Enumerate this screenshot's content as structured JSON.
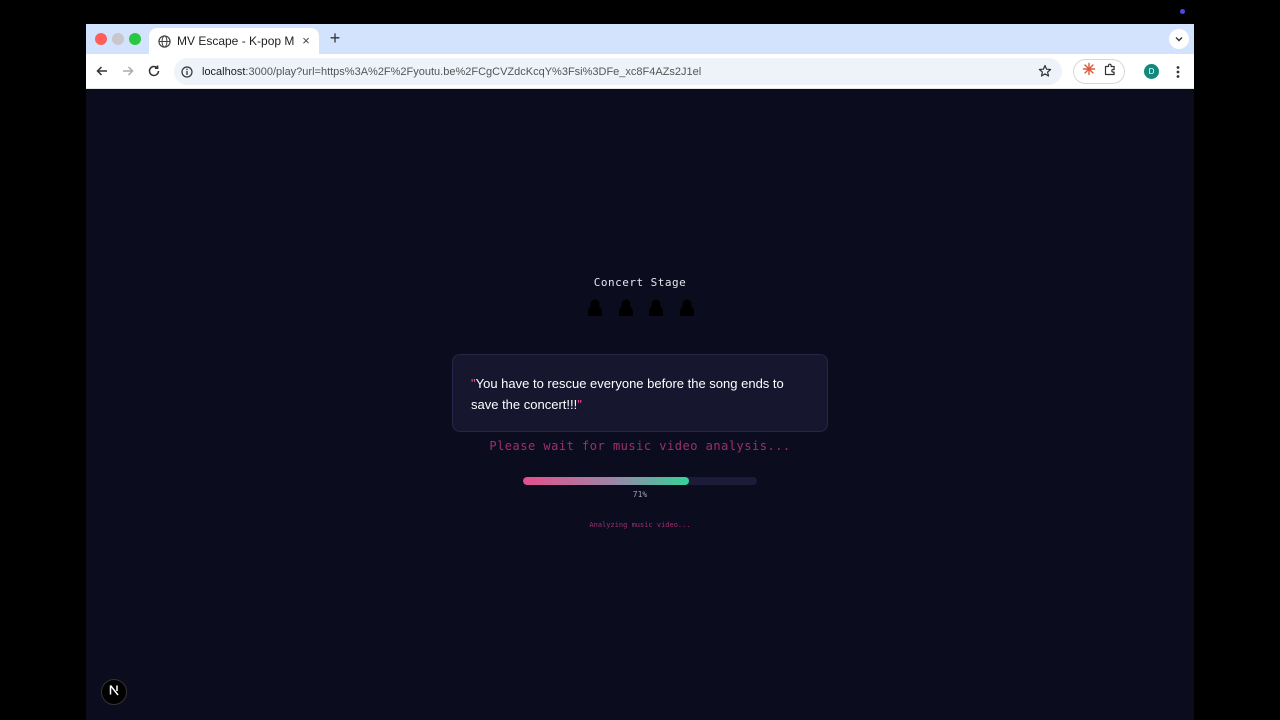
{
  "browser": {
    "tab_title": "MV Escape - K-pop Music Video",
    "new_tab_symbol": "+",
    "close_symbol": "×",
    "url_host": "localhost",
    "url_rest": ":3000/play?url=https%3A%2F%2Fyoutu.be%2FCgCVZdcKcqY%3Fsi%3DFe_xc8F4AZs2J1el",
    "profile_initial": "D"
  },
  "game": {
    "stage_title": "Concert Stage",
    "member_count": 4,
    "quote_open": "\"",
    "quote_text": "You have to rescue everyone before the song ends to save the concert!!!",
    "quote_close": "\"",
    "wait_message": "Please wait for music video analysis...",
    "progress_percent": 71,
    "progress_label": "71%",
    "status_message": "Analyzing music video..."
  },
  "colors": {
    "background": "#0c0c1f",
    "accent_pink": "#ec4899",
    "accent_green": "#34d399"
  },
  "dev": {
    "badge_letter": "N"
  }
}
